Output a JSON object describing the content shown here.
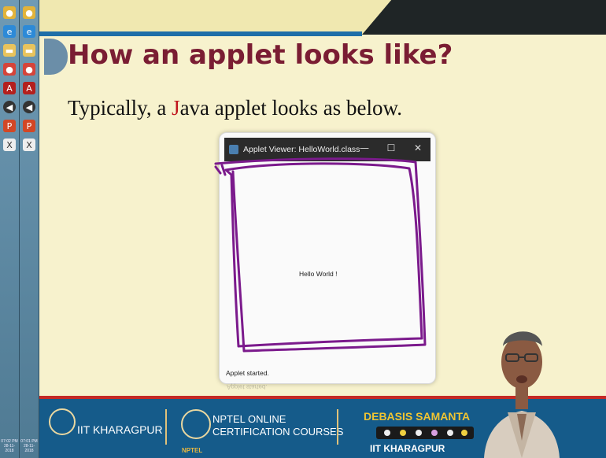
{
  "taskbar": {
    "icons": [
      "chrome-icon",
      "edge-icon",
      "folder-icon",
      "chrome-icon",
      "acrobat-icon",
      "media-icon",
      "powerpoint-icon",
      "camtasia-icon"
    ],
    "clock_left": "07:02 PM 28-11-2018",
    "clock_right": "07:01 PM 28-11-2018"
  },
  "slide": {
    "title": "How an applet looks like?",
    "subtitle_pre": "Typically, a ",
    "subtitle_j": "J",
    "subtitle_post": "ava applet looks as below."
  },
  "applet_window": {
    "title": "Applet Viewer: HelloWorld.class",
    "minimize": "—",
    "maximize": "☐",
    "close": "✕",
    "content_text": "Hello World !",
    "status": "Applet started.",
    "reflection_text": "Applet started."
  },
  "footer": {
    "iit": "IIT KHARAGPUR",
    "nptel_line1": "NPTEL ONLINE",
    "nptel_line2": "CERTIFICATION COURSES",
    "nptel_small": "NPTEL",
    "presenter_name": "DEBASIS SAMANTA",
    "presenter_org": "IIT KHARAGPUR"
  },
  "colors": {
    "slide_bg": "#f7f2cd",
    "title": "#7a1d33",
    "accent_red": "#c0161e",
    "footer_blue": "#155b8a",
    "name_gold": "#f0c432",
    "annotation_purple": "#7b1a8c"
  }
}
